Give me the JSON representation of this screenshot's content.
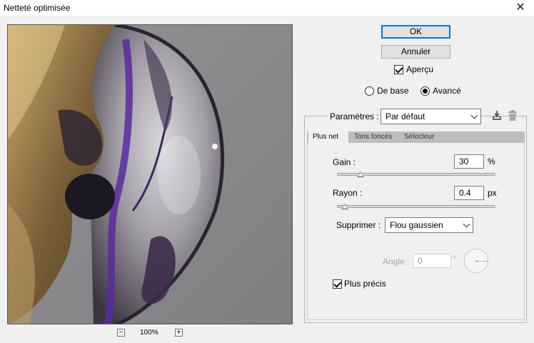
{
  "window": {
    "title": "Netteté optimisée",
    "close_glyph": "✕"
  },
  "preview": {
    "zoom": "100%",
    "zoom_out_glyph": "−",
    "zoom_in_glyph": "+"
  },
  "buttons": {
    "ok": "OK",
    "cancel": "Annuler"
  },
  "apercu": {
    "label": "Aperçu",
    "checked": true
  },
  "mode": {
    "basic_label": "De base",
    "advanced_label": "Avancé",
    "selected": "Avancé"
  },
  "params": {
    "label": "Paramètres :",
    "value": "Par défaut",
    "save_icon": "save-preset-icon",
    "delete_icon": "trash-icon"
  },
  "tabs": [
    "Plus net",
    "Tons foncés",
    "Sélecteur"
  ],
  "gain": {
    "label": "Gain :",
    "value": "30",
    "unit": "%",
    "level": 0.15
  },
  "rayon": {
    "label": "Rayon :",
    "value": "0.4",
    "unit": "px",
    "level": 0.05
  },
  "supprimer": {
    "label": "Supprimer :",
    "value": "Flou gaussien"
  },
  "angle": {
    "label": "Angle :",
    "value": "0",
    "unit": "°"
  },
  "precise": {
    "label": "Plus précis",
    "checked": true
  },
  "colors": {
    "focus_blue": "#0078d7",
    "dialog_bg": "#f0f0f0"
  }
}
